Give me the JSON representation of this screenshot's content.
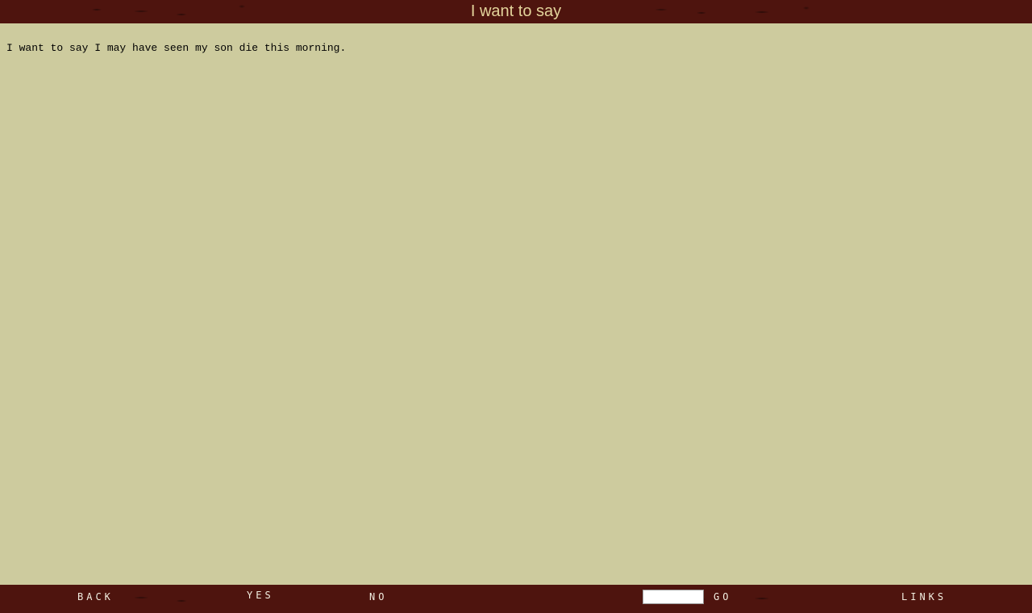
{
  "header": {
    "title": "I want to say"
  },
  "main": {
    "text": "I want to say I may have seen my son die this morning."
  },
  "footer": {
    "back_label": "BACK",
    "yes_label": "YES",
    "no_label": "NO",
    "go_input_value": "",
    "go_label": "GO",
    "links_label": "LINKS"
  },
  "colors": {
    "bar_background": "#4e140e",
    "page_background": "#cdcb9e",
    "title_text": "#e3d39b",
    "nav_text": "#f2eee0"
  }
}
